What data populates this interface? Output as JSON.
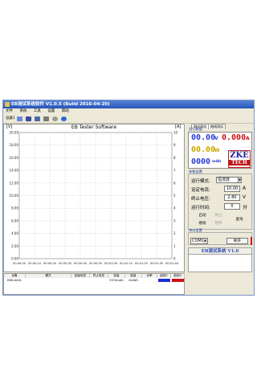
{
  "window": {
    "title": "EB测试系统软件 V1.0.5 (Build 2016-04-20)"
  },
  "menu": [
    "文件",
    "系统",
    "工具",
    "设置",
    "帮助"
  ],
  "toolbar": {
    "device_label": "设备1"
  },
  "chart": {
    "title": "EB Tester Software",
    "left_unit": "[V]",
    "right_unit": "[A]",
    "watermark": "ZKETECH"
  },
  "chart_data": {
    "type": "line",
    "title": "EB Tester Software",
    "ylabel_left": "[V]",
    "ylabel_right": "[A]",
    "y_left_ticks": [
      "0.00",
      "2.00",
      "4.00",
      "6.00",
      "8.00",
      "10.00",
      "12.00",
      "14.00",
      "16.00",
      "18.00",
      "20.00"
    ],
    "y_right_ticks": [
      "0",
      "1",
      "2",
      "3",
      "4",
      "5",
      "6",
      "7",
      "8",
      "9",
      "10"
    ],
    "x_ticks": [
      "00:00:00",
      "00:00:10",
      "00:00:20",
      "00:00:30",
      "00:00:40",
      "00:00:50",
      "00:01:00",
      "00:01:10",
      "00:01:20",
      "00:01:30",
      "00:01:40"
    ],
    "ylim_left": [
      0,
      20
    ],
    "ylim_right": [
      0,
      10
    ],
    "grid": true,
    "series": []
  },
  "right_panel": {
    "tabs": [
      "测试测试",
      "曲线测试"
    ],
    "display_label": "运行数据",
    "voltage": {
      "value": "00.00",
      "unit": "V"
    },
    "current": {
      "value": "0.000",
      "unit": "A"
    },
    "power": {
      "value": "00.00",
      "unit": "W"
    },
    "capacity": {
      "value": "0000",
      "unit": "mAh"
    },
    "logo_top": "ZKE",
    "logo_bottom": "TECH",
    "params_label": "参数设置",
    "mode": {
      "label": "运行模式:",
      "value": "恒流放"
    },
    "set_current": {
      "label": "设定电流:",
      "value": "10.00",
      "unit": "A"
    },
    "cutoff_voltage": {
      "label": "终止电压:",
      "value": "2.80",
      "unit": "V"
    },
    "run_time": {
      "label": "运行时间:",
      "value": "0",
      "unit": "分"
    },
    "buttons": {
      "start": "启动",
      "stop": "停止",
      "continue": "继续",
      "pause": "暂停",
      "query": "查询"
    },
    "port_label": "串口设置",
    "port": "COM9",
    "open": "断开",
    "logo2": "EB测试系统 V1.0"
  },
  "table": {
    "headers": [
      "设备",
      "模式",
      "起始电压",
      "终止电压",
      "容量",
      "能量",
      "功率",
      "曲线V",
      "曲线A"
    ],
    "row": [
      "EBD-A40L",
      "",
      "",
      "",
      "5574mAh",
      "0mWh",
      "",
      "",
      ""
    ]
  },
  "colors": {
    "curve_v": "#1c2fd0",
    "curve_a": "#d01010",
    "lcd_blue": "#2a3cd8",
    "lcd_red": "#d01010",
    "lcd_yellow": "#c8a800"
  }
}
